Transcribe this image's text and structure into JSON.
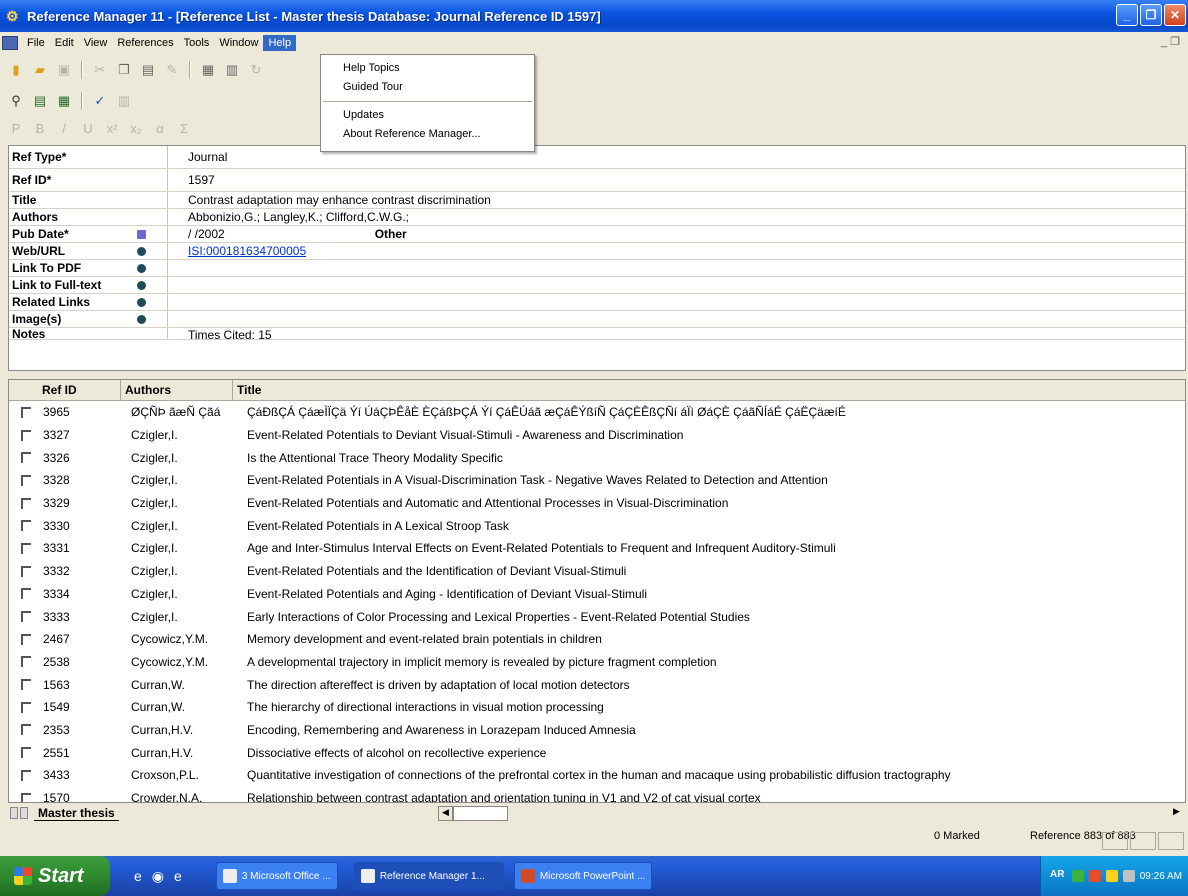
{
  "window": {
    "title": "Reference Manager 11 - [Reference List - Master thesis Database: Journal Reference ID 1597]"
  },
  "menubar": {
    "items": [
      "File",
      "Edit",
      "View",
      "References",
      "Tools",
      "Window",
      "Help"
    ],
    "active": "Help"
  },
  "help_menu": {
    "items": [
      "Help Topics",
      "Guided Tour",
      "Updates",
      "About Reference Manager..."
    ]
  },
  "detail": {
    "ref_type_label": "Ref Type*",
    "ref_type_value": "Journal",
    "ref_id_label": "Ref ID*",
    "ref_id_value": "1597",
    "title_label": "Title",
    "title_value": "Contrast adaptation may enhance contrast discrimination",
    "authors_label": "Authors",
    "authors_value": "Abbonizio,G.; Langley,K.; Clifford,C.W.G.;",
    "pub_date_label": "Pub Date*",
    "pub_date_value": " / /2002",
    "other_label": "Other",
    "url_label": "Web/URL",
    "url_value": "ISI:000181634700005",
    "pdf_label": "Link To PDF",
    "fulltext_label": "Link to Full-text",
    "related_label": "Related Links",
    "images_label": "Image(s)",
    "notes_label": "Notes",
    "notes_value": "Times Cited: 15"
  },
  "list": {
    "headers": {
      "ref_id": "Ref ID",
      "authors": "Authors",
      "title": "Title"
    },
    "rows": [
      {
        "id": "3965",
        "author": "ØÇÑÞ ãæÑ Çãá",
        "title": "ÇáÐßÇÁ ÇáæÌÏÇä Ýí ÚáÇÞÊåÈ ÈÇáßÞÇÁ Ýí ÇáÊÚáã æÇáÊÝßíÑ ÇáÇÈÊßÇÑí áÏì ØáÇÈ ÇáãÑÍáÉ ÇáËÇäæíÉ"
      },
      {
        "id": "3327",
        "author": "Czigler,I.",
        "title": "Event-Related Potentials to Deviant Visual-Stimuli - Awareness and Discrimination"
      },
      {
        "id": "3326",
        "author": "Czigler,I.",
        "title": "Is the Attentional Trace Theory Modality Specific"
      },
      {
        "id": "3328",
        "author": "Czigler,I.",
        "title": "Event-Related Potentials in A Visual-Discrimination Task - Negative Waves Related to Detection and Attention"
      },
      {
        "id": "3329",
        "author": "Czigler,I.",
        "title": "Event-Related Potentials and Automatic and Attentional Processes in Visual-Discrimination"
      },
      {
        "id": "3330",
        "author": "Czigler,I.",
        "title": "Event-Related Potentials in A Lexical Stroop Task"
      },
      {
        "id": "3331",
        "author": "Czigler,I.",
        "title": "Age and Inter-Stimulus Interval Effects on Event-Related Potentials to Frequent and Infrequent Auditory-Stimuli"
      },
      {
        "id": "3332",
        "author": "Czigler,I.",
        "title": "Event-Related Potentials and the Identification of Deviant Visual-Stimuli"
      },
      {
        "id": "3334",
        "author": "Czigler,I.",
        "title": "Event-Related Potentials and Aging - Identification of Deviant Visual-Stimuli"
      },
      {
        "id": "3333",
        "author": "Czigler,I.",
        "title": "Early Interactions of Color Processing and Lexical Properties - Event-Related Potential Studies"
      },
      {
        "id": "2467",
        "author": "Cycowicz,Y.M.",
        "title": "Memory development and event-related brain potentials in children"
      },
      {
        "id": "2538",
        "author": "Cycowicz,Y.M.",
        "title": "A developmental trajectory in implicit memory is revealed by picture fragment completion"
      },
      {
        "id": "1563",
        "author": "Curran,W.",
        "title": "The direction aftereffect is driven by adaptation of local motion detectors"
      },
      {
        "id": "1549",
        "author": "Curran,W.",
        "title": "The hierarchy of directional interactions in visual motion processing"
      },
      {
        "id": "2353",
        "author": "Curran,H.V.",
        "title": "Encoding, Remembering and Awareness in Lorazepam Induced Amnesia"
      },
      {
        "id": "2551",
        "author": "Curran,H.V.",
        "title": "Dissociative effects of alcohol on recollective experience"
      },
      {
        "id": "3433",
        "author": "Croxson,P.L.",
        "title": "Quantitative investigation of connections of the prefrontal cortex in the human and macaque using probabilistic diffusion tractography"
      },
      {
        "id": "1570",
        "author": "Crowder,N.A.",
        "title": "Relationship between contrast adaptation and orientation tuning in V1 and V2 of cat visual cortex"
      }
    ]
  },
  "sheet_tab": "Master thesis",
  "status": {
    "marked": "0 Marked",
    "reference": "Reference 883 of 883"
  },
  "taskbar": {
    "start_label": "Start",
    "tasks": [
      "3 Microsoft Office ...",
      "Reference Manager 1...",
      "Microsoft PowerPoint ..."
    ],
    "language": "AR",
    "clock": "09:26 AM"
  }
}
